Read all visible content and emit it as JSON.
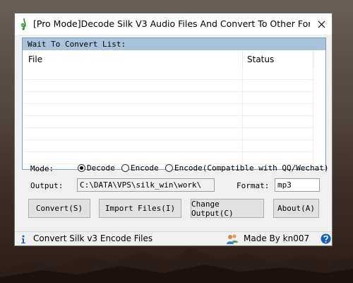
{
  "window": {
    "title": "[Pro Mode]Decode Silk V3 Audio Files And Convert To Other For..."
  },
  "list": {
    "caption": "Wait To Convert List:",
    "columns": [
      "File",
      "Status"
    ]
  },
  "form": {
    "mode_label": "Mode:",
    "modes": [
      {
        "label": "Decode",
        "selected": true
      },
      {
        "label": "Encode",
        "selected": false
      },
      {
        "label": "Encode(Compatible with QQ/Wechat)",
        "selected": false
      }
    ],
    "output_label": "Output:",
    "output_value": "C:\\DATA\\VPS\\silk_win\\work\\",
    "format_label": "Format:",
    "format_value": "mp3"
  },
  "buttons": {
    "convert": "Convert(S)",
    "import": "Import Files(I)",
    "change_output": "Change Output(C)",
    "about": "About(A)"
  },
  "statusbar": {
    "left_text": "Convert Silk v3 Encode Files",
    "right_text": "Made By kn007"
  },
  "icons": {
    "app": "music-note-icon",
    "close": "close-icon",
    "info": "info-icon",
    "users": "users-icon",
    "help": "help-icon"
  }
}
